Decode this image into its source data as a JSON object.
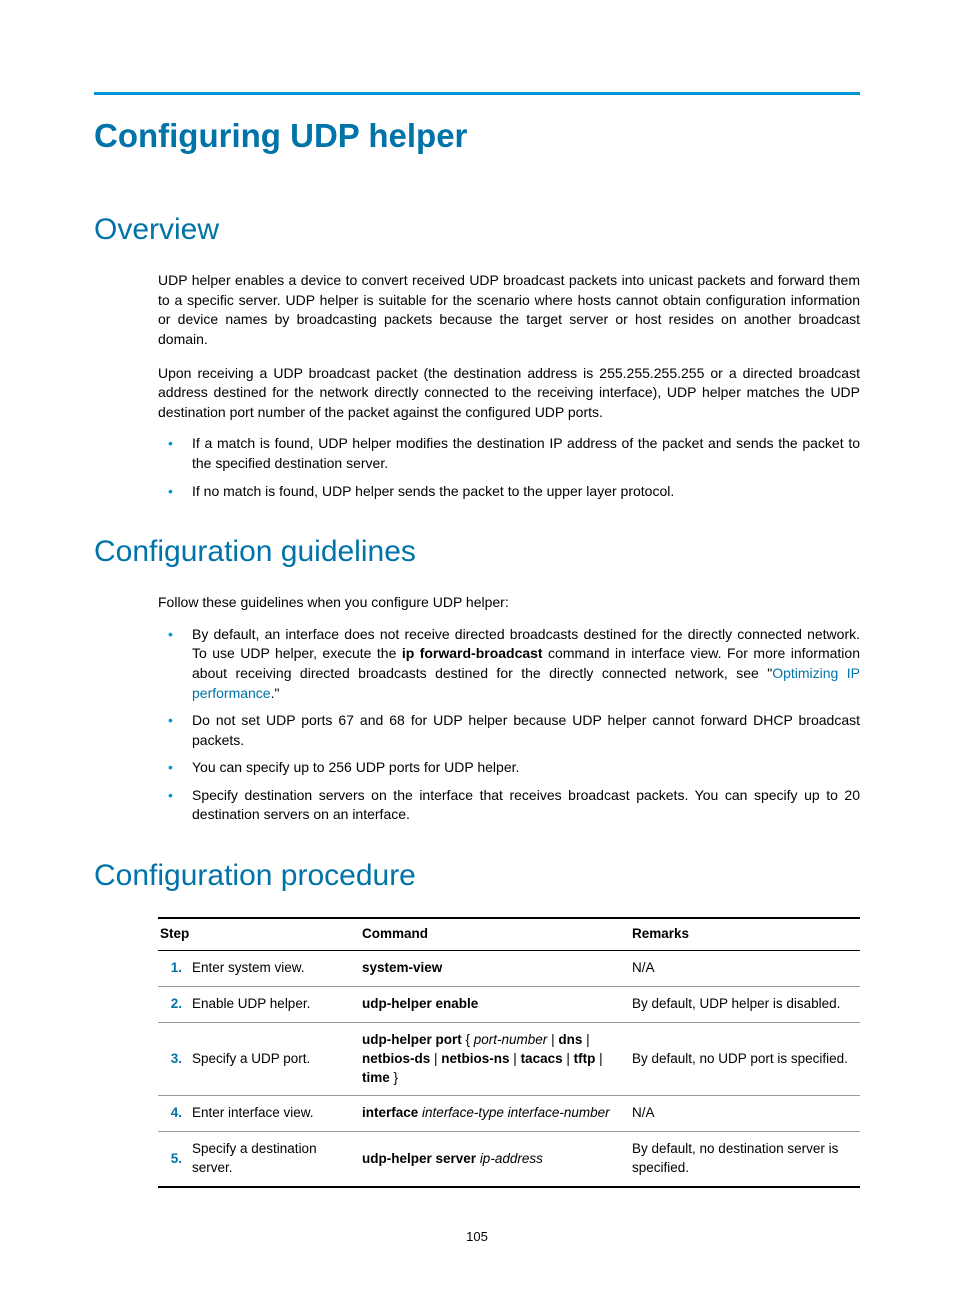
{
  "title": "Configuring UDP helper",
  "sections": {
    "overview": {
      "heading": "Overview",
      "p1": "UDP helper enables a device to convert received UDP broadcast packets into unicast packets and forward them to a specific server. UDP helper is suitable for the scenario where hosts cannot obtain configuration information or device names by broadcasting packets because the target server or host resides on another broadcast domain.",
      "p2": "Upon receiving a UDP broadcast packet (the destination address is 255.255.255.255 or a directed broadcast address destined for the network directly connected to the receiving interface), UDP helper matches the UDP destination port number of the packet against the configured UDP ports.",
      "b1": "If a match is found, UDP helper modifies the destination IP address of the packet and sends the packet to the specified destination server.",
      "b2": "If no match is found, UDP helper sends the packet to the upper layer protocol."
    },
    "guidelines": {
      "heading": "Configuration guidelines",
      "p1": "Follow these guidelines when you configure UDP helper:",
      "b1_pre": "By default, an interface does not receive directed broadcasts destined for the directly connected network. To use UDP helper, execute the ",
      "b1_bold": "ip forward-broadcast",
      "b1_mid": " command in interface view. For more information about receiving directed broadcasts destined for the directly connected network, see \"",
      "b1_link": "Optimizing IP performance",
      "b1_post": ".\"",
      "b2": "Do not set UDP ports 67 and 68 for UDP helper because UDP helper cannot forward DHCP broadcast packets.",
      "b3": "You can specify up to 256 UDP ports for UDP helper.",
      "b4": "Specify destination servers on the interface that receives broadcast packets. You can specify up to 20 destination servers on an interface."
    },
    "procedure": {
      "heading": "Configuration procedure",
      "headers": {
        "step": "Step",
        "command": "Command",
        "remarks": "Remarks"
      },
      "rows": [
        {
          "num": "1.",
          "step": "Enter system view.",
          "cmd_bold1": "system-view",
          "remarks": "N/A"
        },
        {
          "num": "2.",
          "step": "Enable UDP helper.",
          "cmd_bold1": "udp-helper enable",
          "remarks": "By default, UDP helper is disabled."
        },
        {
          "num": "3.",
          "step": "Specify a UDP port.",
          "cmd_bold1": "udp-helper port",
          "cmd_plain1": " { ",
          "cmd_ital1": "port-number",
          "cmd_plain2": " | ",
          "cmd_bold2": "dns",
          "cmd_plain3": " | ",
          "cmd_bold3": "netbios-ds",
          "cmd_plain4": " | ",
          "cmd_bold4": "netbios-ns",
          "cmd_plain5": " | ",
          "cmd_bold5": "tacacs",
          "cmd_plain6": " | ",
          "cmd_bold6": "tftp",
          "cmd_plain7": " | ",
          "cmd_bold7": "time",
          "cmd_plain8": " }",
          "remarks": "By default, no UDP port is specified."
        },
        {
          "num": "4.",
          "step": "Enter interface view.",
          "cmd_bold1": "interface",
          "cmd_plain1": " ",
          "cmd_ital1": "interface-type interface-number",
          "remarks": "N/A"
        },
        {
          "num": "5.",
          "step": "Specify a destination server.",
          "cmd_bold1": "udp-helper server",
          "cmd_plain1": " ",
          "cmd_ital1": "ip-address",
          "remarks": "By default, no destination server is specified."
        }
      ]
    }
  },
  "page_number": "105"
}
